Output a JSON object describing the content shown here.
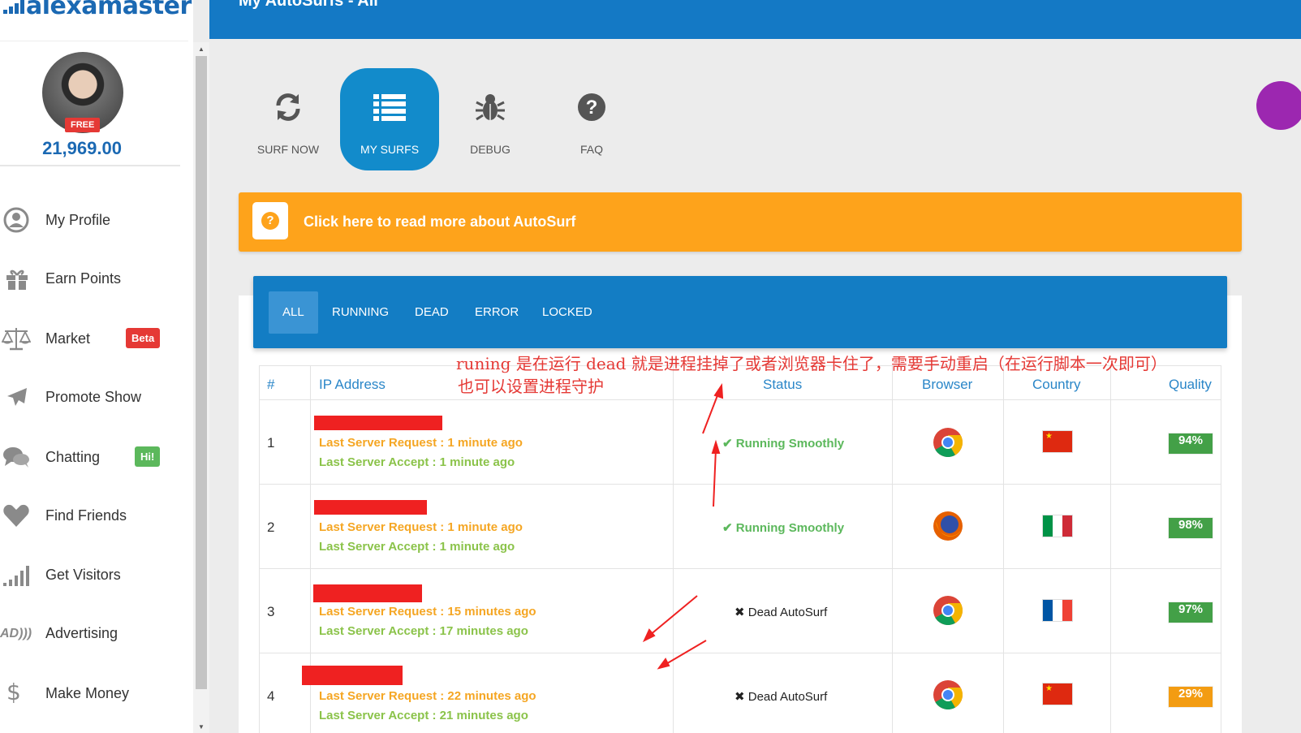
{
  "sidebar": {
    "logo_text": "alexamaster",
    "free_badge": "FREE",
    "points": "21,969.00",
    "items": [
      {
        "label": "My Profile",
        "icon": "user-icon"
      },
      {
        "label": "Earn Points",
        "icon": "gift-icon"
      },
      {
        "label": "Market",
        "icon": "scale-icon",
        "badge": "Beta",
        "badge_color": "#e53935"
      },
      {
        "label": "Promote Show",
        "icon": "plane-icon"
      },
      {
        "label": "Chatting",
        "icon": "chat-icon",
        "badge": "Hi!",
        "badge_color": "#5cb85c"
      },
      {
        "label": "Find Friends",
        "icon": "heart-icon"
      },
      {
        "label": "Get Visitors",
        "icon": "signal-bars-icon"
      },
      {
        "label": "Advertising",
        "icon": "ad-icon",
        "icon_text": "AD)))"
      },
      {
        "label": "Make Money",
        "icon": "dollar-icon",
        "icon_text": "$"
      }
    ]
  },
  "header": {
    "title": "My AutoSurfs - All"
  },
  "tabs": [
    {
      "label": "SURF NOW",
      "icon": "refresh-icon"
    },
    {
      "label": "MY SURFS",
      "icon": "list-icon",
      "active": true
    },
    {
      "label": "DEBUG",
      "icon": "bug-icon"
    },
    {
      "label": "FAQ",
      "icon": "question-circle-icon"
    }
  ],
  "banner": {
    "text": "Click here to read more about AutoSurf",
    "icon_text": "?"
  },
  "filters": [
    "ALL",
    "RUNNING",
    "DEAD",
    "ERROR",
    "LOCKED"
  ],
  "table": {
    "headers": [
      "#",
      "IP Address",
      "Status",
      "Browser",
      "Country",
      "Quality"
    ],
    "rows": [
      {
        "num": "1",
        "request": "Last Server Request : 1 minute ago",
        "accept": "Last Server Accept : 1 minute ago",
        "status_icon": "✔",
        "status": "Running Smoothly",
        "status_type": "run",
        "browser": "chrome-icon",
        "country": "china-flag",
        "quality": "94%",
        "quality_color": "#43a047"
      },
      {
        "num": "2",
        "request": "Last Server Request : 1 minute ago",
        "accept": "Last Server Accept : 1 minute ago",
        "status_icon": "✔",
        "status": "Running Smoothly",
        "status_type": "run",
        "browser": "firefox-icon",
        "country": "italy-flag",
        "quality": "98%",
        "quality_color": "#43a047"
      },
      {
        "num": "3",
        "request": "Last Server Request : 15 minutes ago",
        "accept": "Last Server Accept : 17 minutes ago",
        "status_icon": "✖",
        "status": "Dead AutoSurf",
        "status_type": "dead",
        "browser": "chrome-icon",
        "country": "france-flag",
        "quality": "97%",
        "quality_color": "#43a047"
      },
      {
        "num": "4",
        "request": "Last Server Request : 22 minutes ago",
        "accept": "Last Server Accept : 21 minutes ago",
        "status_icon": "✖",
        "status": "Dead AutoSurf",
        "status_type": "dead",
        "browser": "chrome-icon",
        "country": "china-flag",
        "quality": "29%",
        "quality_color": "#f39c12"
      }
    ]
  },
  "annotation": {
    "line1": "runing 是在运行  dead 就是进程挂掉了或者浏览器卡住了，需要手动重启（在运行脚本一次即可）",
    "line2": "也可以设置进程守护"
  }
}
